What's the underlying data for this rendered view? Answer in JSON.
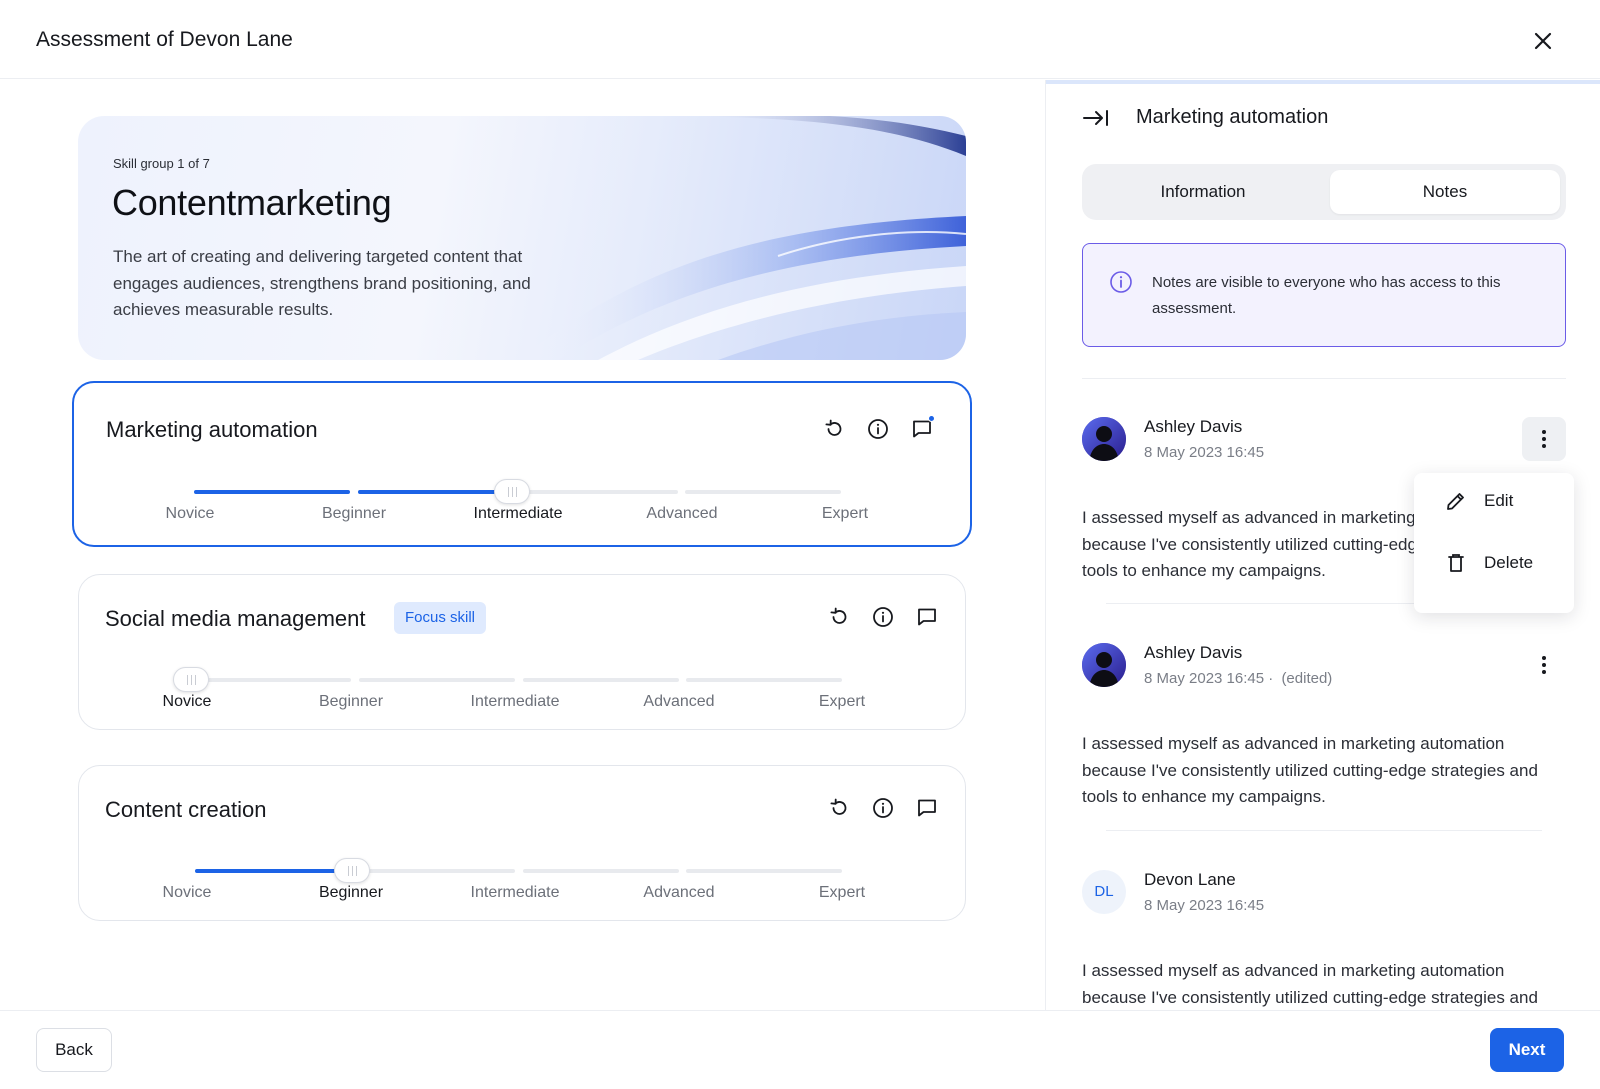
{
  "window": {
    "title": "Assessment of Devon Lane",
    "close_icon": "close-icon"
  },
  "skill_group": {
    "counter": "Skill group 1 of 7",
    "title": "Contentmarketing",
    "description": "The art of creating and delivering targeted content that engages audiences, strengthens brand positioning, and achieves measurable results."
  },
  "levels": [
    "Novice",
    "Beginner",
    "Intermediate",
    "Advanced",
    "Expert"
  ],
  "skills": [
    {
      "name": "Marketing automation",
      "badge": "",
      "selected_level": "Intermediate",
      "has_notes": true
    },
    {
      "name": "Social media management",
      "badge": "Focus skill",
      "selected_level": "Novice",
      "has_notes": false
    },
    {
      "name": "Content creation",
      "badge": "",
      "selected_level": "Beginner",
      "has_notes": false
    }
  ],
  "panel": {
    "title": "Marketing automation",
    "tabs": [
      "Information",
      "Notes"
    ],
    "active_tab": "Notes",
    "notice": "Notes are visible to everyone who has access to this assessment.",
    "notes": [
      {
        "author": "Ashley Davis",
        "date": "8 May 2023 16:45",
        "edited": "",
        "initials": "",
        "body": "I assessed myself as advanced in marketing automation because I've consistently utilized cutting-edge strategies and tools to enhance my campaigns."
      },
      {
        "author": "Ashley Davis",
        "date": "8 May 2023 16:45",
        "edited": "(edited)",
        "initials": "",
        "body": "I assessed myself as advanced in marketing automation because I've consistently utilized cutting-edge strategies and tools to enhance my campaigns."
      },
      {
        "author": "Devon Lane",
        "date": "8 May 2023 16:45",
        "edited": "",
        "initials": "DL",
        "body": "I assessed myself as advanced in marketing automation because I've consistently utilized cutting-edge strategies and tools to enhance my campaigns."
      }
    ],
    "context_menu": {
      "edit": "Edit",
      "delete": "Delete"
    }
  },
  "footer": {
    "back": "Back",
    "next": "Next"
  },
  "colors": {
    "accent": "#1c63e6",
    "notice_border": "#6b5ce7",
    "badge_bg": "#dfeafe"
  }
}
